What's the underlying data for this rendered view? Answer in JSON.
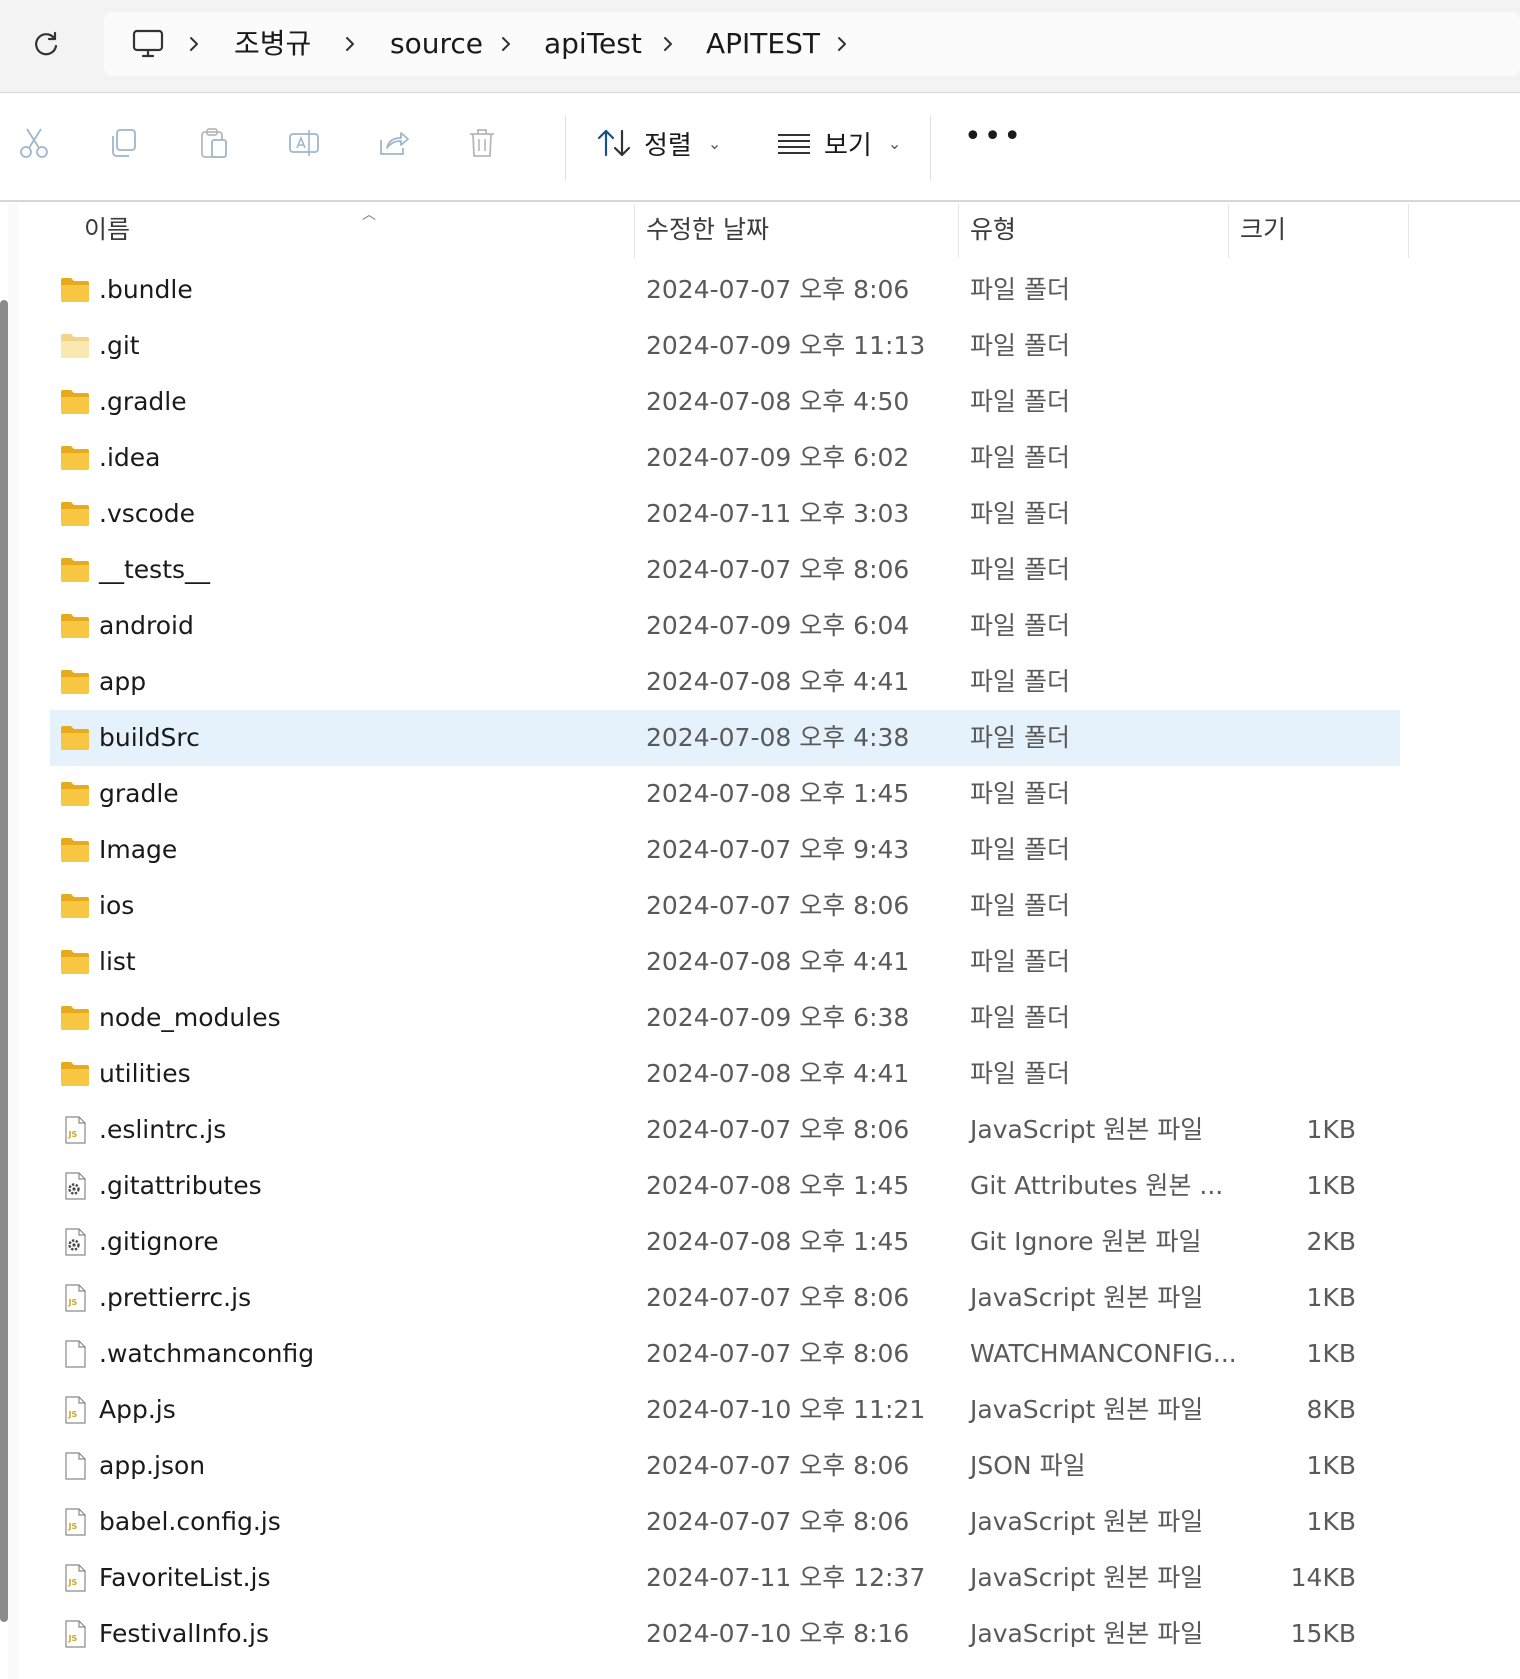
{
  "breadcrumb": {
    "items": [
      "조병규",
      "source",
      "apiTest",
      "APITEST"
    ]
  },
  "toolbar": {
    "sort_label": "정렬",
    "view_label": "보기",
    "more_label": "•••"
  },
  "columns": {
    "name": "이름",
    "modified": "수정한 날짜",
    "type": "유형",
    "size": "크기"
  },
  "files": [
    {
      "name": ".bundle",
      "date": "2024-07-07 오후 8:06",
      "type": "파일 폴더",
      "size": "",
      "icon": "folder-icon",
      "selected": false
    },
    {
      "name": ".git",
      "date": "2024-07-09 오후 11:13",
      "type": "파일 폴더",
      "size": "",
      "icon": "folder-hidden-icon",
      "selected": false
    },
    {
      "name": ".gradle",
      "date": "2024-07-08 오후 4:50",
      "type": "파일 폴더",
      "size": "",
      "icon": "folder-icon",
      "selected": false
    },
    {
      "name": ".idea",
      "date": "2024-07-09 오후 6:02",
      "type": "파일 폴더",
      "size": "",
      "icon": "folder-icon",
      "selected": false
    },
    {
      "name": ".vscode",
      "date": "2024-07-11 오후 3:03",
      "type": "파일 폴더",
      "size": "",
      "icon": "folder-icon",
      "selected": false
    },
    {
      "name": "__tests__",
      "date": "2024-07-07 오후 8:06",
      "type": "파일 폴더",
      "size": "",
      "icon": "folder-icon",
      "selected": false
    },
    {
      "name": "android",
      "date": "2024-07-09 오후 6:04",
      "type": "파일 폴더",
      "size": "",
      "icon": "folder-icon",
      "selected": false
    },
    {
      "name": "app",
      "date": "2024-07-08 오후 4:41",
      "type": "파일 폴더",
      "size": "",
      "icon": "folder-icon",
      "selected": false
    },
    {
      "name": "buildSrc",
      "date": "2024-07-08 오후 4:38",
      "type": "파일 폴더",
      "size": "",
      "icon": "folder-icon",
      "selected": true
    },
    {
      "name": "gradle",
      "date": "2024-07-08 오후 1:45",
      "type": "파일 폴더",
      "size": "",
      "icon": "folder-icon",
      "selected": false
    },
    {
      "name": "Image",
      "date": "2024-07-07 오후 9:43",
      "type": "파일 폴더",
      "size": "",
      "icon": "folder-icon",
      "selected": false
    },
    {
      "name": "ios",
      "date": "2024-07-07 오후 8:06",
      "type": "파일 폴더",
      "size": "",
      "icon": "folder-icon",
      "selected": false
    },
    {
      "name": "list",
      "date": "2024-07-08 오후 4:41",
      "type": "파일 폴더",
      "size": "",
      "icon": "folder-icon",
      "selected": false
    },
    {
      "name": "node_modules",
      "date": "2024-07-09 오후 6:38",
      "type": "파일 폴더",
      "size": "",
      "icon": "folder-icon",
      "selected": false
    },
    {
      "name": "utilities",
      "date": "2024-07-08 오후 4:41",
      "type": "파일 폴더",
      "size": "",
      "icon": "folder-icon",
      "selected": false
    },
    {
      "name": ".eslintrc.js",
      "date": "2024-07-07 오후 8:06",
      "type": "JavaScript 원본 파일",
      "size": "1KB",
      "icon": "js-file-icon",
      "selected": false
    },
    {
      "name": ".gitattributes",
      "date": "2024-07-08 오후 1:45",
      "type": "Git Attributes 원본 ...",
      "size": "1KB",
      "icon": "config-file-icon",
      "selected": false
    },
    {
      "name": ".gitignore",
      "date": "2024-07-08 오후 1:45",
      "type": "Git Ignore 원본 파일",
      "size": "2KB",
      "icon": "config-file-icon",
      "selected": false
    },
    {
      "name": ".prettierrc.js",
      "date": "2024-07-07 오후 8:06",
      "type": "JavaScript 원본 파일",
      "size": "1KB",
      "icon": "js-file-icon",
      "selected": false
    },
    {
      "name": ".watchmanconfig",
      "date": "2024-07-07 오후 8:06",
      "type": "WATCHMANCONFIG...",
      "size": "1KB",
      "icon": "blank-file-icon",
      "selected": false
    },
    {
      "name": "App.js",
      "date": "2024-07-10 오후 11:21",
      "type": "JavaScript 원본 파일",
      "size": "8KB",
      "icon": "js-file-icon",
      "selected": false
    },
    {
      "name": "app.json",
      "date": "2024-07-07 오후 8:06",
      "type": "JSON 파일",
      "size": "1KB",
      "icon": "blank-file-icon",
      "selected": false
    },
    {
      "name": "babel.config.js",
      "date": "2024-07-07 오후 8:06",
      "type": "JavaScript 원본 파일",
      "size": "1KB",
      "icon": "js-file-icon",
      "selected": false
    },
    {
      "name": "FavoriteList.js",
      "date": "2024-07-11 오후 12:37",
      "type": "JavaScript 원본 파일",
      "size": "14KB",
      "icon": "js-file-icon",
      "selected": false
    },
    {
      "name": "FestivalInfo.js",
      "date": "2024-07-10 오후 8:16",
      "type": "JavaScript 원본 파일",
      "size": "15KB",
      "icon": "js-file-icon",
      "selected": false
    }
  ],
  "colors": {
    "selection": "#e5f1fb",
    "folder": "#f7c642",
    "folder_hidden": "#fbe7b0",
    "js_badge": "#c8a824"
  }
}
